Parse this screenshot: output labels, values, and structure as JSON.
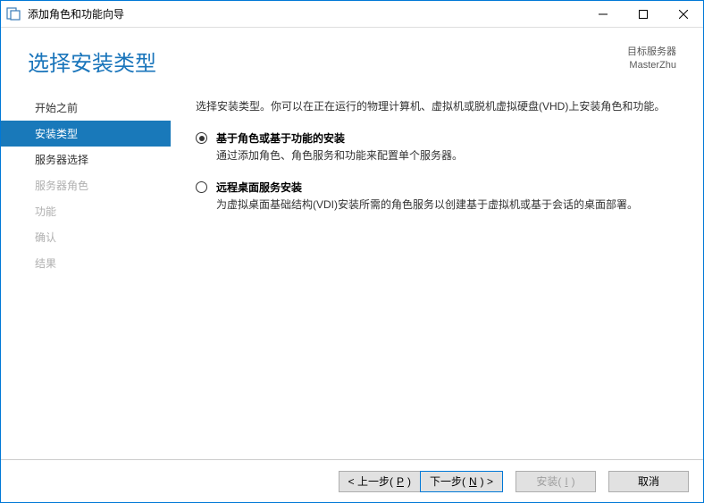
{
  "titlebar": {
    "title": "添加角色和功能向导"
  },
  "header": {
    "title": "选择安装类型",
    "dest_label": "目标服务器",
    "dest_value": "MasterZhu"
  },
  "sidebar": {
    "items": [
      {
        "label": "开始之前",
        "state": "normal"
      },
      {
        "label": "安装类型",
        "state": "selected"
      },
      {
        "label": "服务器选择",
        "state": "normal"
      },
      {
        "label": "服务器角色",
        "state": "disabled"
      },
      {
        "label": "功能",
        "state": "disabled"
      },
      {
        "label": "确认",
        "state": "disabled"
      },
      {
        "label": "结果",
        "state": "disabled"
      }
    ]
  },
  "content": {
    "description": "选择安装类型。你可以在正在运行的物理计算机、虚拟机或脱机虚拟硬盘(VHD)上安装角色和功能。",
    "options": [
      {
        "title": "基于角色或基于功能的安装",
        "desc": "通过添加角色、角色服务和功能来配置单个服务器。",
        "checked": true
      },
      {
        "title": "远程桌面服务安装",
        "desc": "为虚拟桌面基础结构(VDI)安装所需的角色服务以创建基于虚拟机或基于会话的桌面部署。",
        "checked": false
      }
    ]
  },
  "footer": {
    "prev": "< 上一步(",
    "prev_key": "P",
    "prev_suffix": ")",
    "next": "下一步(",
    "next_key": "N",
    "next_suffix": ") >",
    "install": "安装(",
    "install_key": "I",
    "install_suffix": ")",
    "cancel": "取消"
  }
}
